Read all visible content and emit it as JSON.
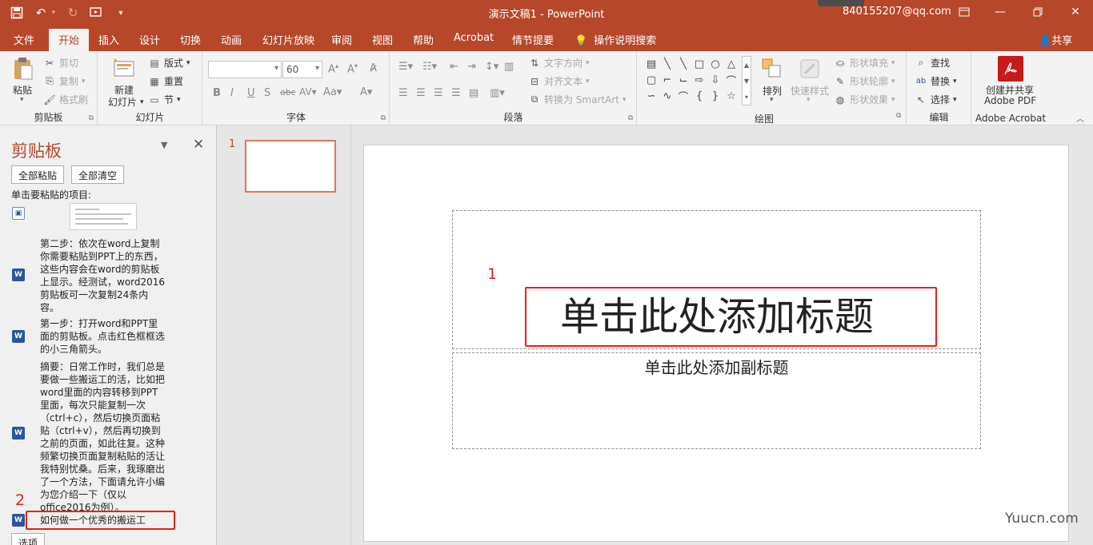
{
  "titlebar": {
    "title": "演示文稿1  -  PowerPoint",
    "user": "840155207@qq.com",
    "qat_icons": [
      "save-icon",
      "undo-icon",
      "redo-icon",
      "present-icon",
      "customize-icon"
    ]
  },
  "tabs": [
    {
      "label": "文件"
    },
    {
      "label": "开始"
    },
    {
      "label": "插入"
    },
    {
      "label": "设计"
    },
    {
      "label": "切换"
    },
    {
      "label": "动画"
    },
    {
      "label": "幻灯片放映"
    },
    {
      "label": "审阅"
    },
    {
      "label": "视图"
    },
    {
      "label": "帮助"
    },
    {
      "label": "Acrobat"
    },
    {
      "label": "情节提要"
    },
    {
      "label": "操作说明搜索"
    }
  ],
  "share": "共享",
  "ribbon": {
    "clipboard": {
      "label": "剪贴板",
      "paste": "粘贴",
      "cut": "剪切",
      "copy": "复制",
      "format_painter": "格式刷"
    },
    "slides": {
      "label": "幻灯片",
      "new_slide": "新建",
      "new_slide2": "幻灯片",
      "layout": "版式",
      "reset": "重置",
      "section": "节"
    },
    "font": {
      "label": "字体",
      "font_name": "",
      "font_size": "60"
    },
    "paragraph": {
      "label": "段落",
      "text_direction": "文字方向",
      "align_text": "对齐文本",
      "smartart": "转换为 SmartArt"
    },
    "drawing": {
      "label": "绘图",
      "arrange": "排列",
      "quick_styles": "快速样式",
      "shape_fill": "形状填充",
      "shape_outline": "形状轮廓",
      "shape_effects": "形状效果"
    },
    "editing": {
      "label": "编辑",
      "find": "查找",
      "replace": "替换",
      "select": "选择"
    },
    "acrobat": {
      "label": "Adobe Acrobat",
      "create": "创建并共享",
      "create2": "Adobe PDF"
    }
  },
  "clipboard_pane": {
    "title": "剪贴板",
    "paste_all": "全部粘贴",
    "clear_all": "全部清空",
    "prompt": "单击要粘贴的项目:",
    "item2_lines": [
      "第二步：依次在word上复制",
      "你需要粘贴到PPT上的东西，",
      "这些内容会在word的剪贴板",
      "上显示。经测试，word2016",
      "剪贴板可一次复制24条内",
      "容。"
    ],
    "item3_lines": [
      "第一步：打开word和PPT里",
      "面的剪贴板。点击红色框框选",
      "的小三角箭头。"
    ],
    "item4_lines": [
      "摘要：日常工作时，我们总是",
      "要做一些搬运工的活，比如把",
      "word里面的内容转移到PPT",
      "里面，每次只能复制一次",
      "（ctrl+c），然后切换页面粘",
      "贴（ctrl+v），然后再切换到",
      "之前的页面，如此往复。这种",
      "频繁切换页面复制粘贴的活让",
      "我特别忧桑。后来，我琢磨出",
      "了一个方法，下面请允许小编",
      "为您介绍一下（仅以",
      "office2016为例）。"
    ],
    "item5": "如何做一个优秀的搬运工",
    "marker": "2",
    "options": "选项"
  },
  "thumbnails": {
    "slide_number": "1"
  },
  "slide": {
    "marker": "1",
    "title_placeholder": "单击此处添加标题",
    "subtitle_placeholder": "单击此处添加副标题"
  },
  "watermark": "Yuucn.com",
  "colors": {
    "accent": "#b7472a",
    "annotation": "#e2231a"
  }
}
